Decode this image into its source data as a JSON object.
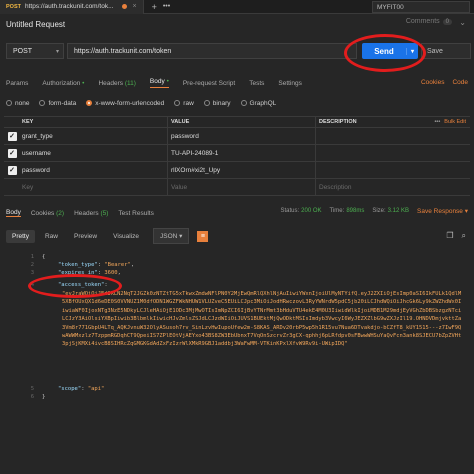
{
  "tabs": [
    {
      "method": "POST",
      "url": "https://auth.trackunit.com/tok..."
    }
  ],
  "environment": "MYFIT00",
  "request": {
    "title": "Untitled Request",
    "comments_label": "Comments",
    "comments_count": "0",
    "method": "POST",
    "url": "https://auth.trackunit.com/token",
    "send_label": "Send",
    "save_label": "Save"
  },
  "request_tabs": [
    {
      "label": "Params"
    },
    {
      "label": "Authorization",
      "indicator": "•"
    },
    {
      "label": "Headers",
      "count": "(11)"
    },
    {
      "label": "Body",
      "indicator": "•"
    },
    {
      "label": "Pre-request Script"
    },
    {
      "label": "Tests"
    },
    {
      "label": "Settings"
    }
  ],
  "request_tab_links": {
    "cookies": "Cookies",
    "code": "Code"
  },
  "body_types": [
    "none",
    "form-data",
    "x-www-form-urlencoded",
    "raw",
    "binary",
    "GraphQL"
  ],
  "body_type_selected": "x-www-form-urlencoded",
  "params_table": {
    "headers": {
      "key": "KEY",
      "value": "VALUE",
      "description": "DESCRIPTION",
      "bulk": "Bulk Edit"
    },
    "rows": [
      {
        "key": "grant_type",
        "value": "password"
      },
      {
        "key": "username",
        "value": "TU-API-24089-1"
      },
      {
        "key": "password",
        "value": "rllXOrn#xi2t_Upy"
      }
    ],
    "placeholders": {
      "key": "Key",
      "value": "Value",
      "description": "Description"
    }
  },
  "response_tabs": [
    {
      "label": "Body"
    },
    {
      "label": "Cookies",
      "count": "(2)"
    },
    {
      "label": "Headers",
      "count": "(5)"
    },
    {
      "label": "Test Results"
    }
  ],
  "response_meta": {
    "status_label": "Status:",
    "status": "200 OK",
    "time_label": "Time:",
    "time": "898ms",
    "size_label": "Size:",
    "size": "3.12 KB",
    "save_label": "Save Response"
  },
  "format_buttons": [
    "Pretty",
    "Raw",
    "Preview",
    "Visualize"
  ],
  "format_selected": "Pretty",
  "format_type": "JSON",
  "code": {
    "line_numbers": [
      "1",
      "2",
      "3",
      "4",
      "5",
      "6"
    ],
    "open_brace": "{",
    "token_type_key": "\"token_type\"",
    "token_type_value": "\"Bearer\"",
    "expires_key": "\"expires_in\"",
    "expires_value": "3600",
    "access_token_key": "\"access_token\"",
    "access_token_value": "\"eyJraWQiOiJEd3RLN2NqT2JGZk0zNTZtTG5xTkwxZmdwNFlPN0Y2MjEwQmRlQXhlNjAuIiwiYWxnIjoiUlMyNTYifQ.eyJ2ZXIiOjEsImp0aSI6IkFULk1QdlM5XBfOUxQX1d6eDE0S0VVNUZ1M0dfODN1WGZFWkNHUW1VLUZveC5EUiLCJpc3MiOiJodHRwczovL3RyYWNrdW5pdC5jb20iLCJhdWQiOiJhcGk6Ly9kZWZhdWx0IiwiaWF0IjoxNTg3NzE5NDkyLCJleHAiOjE1ODc3MjMwOTIsImNpZCI6IjBvYTNrMmt3bHduVTU4ekE4M0U3IiwidWlkIjoiMDB1M29mdjEyVGhZbDBSbzgzNTciLCJzY3AiOlsiYXBpIiwib3BlbmlkIiwicHJvZmlsZSJdLCJzdWIiOiJUVS1BUEktMjQwODktMSIsImdyb3VwcyI6WyJEZXZlbG9wZXJzIl19.OHNDVDmjvkttZa3Vm8r771GbpU4LTq_AQKJvnuW32OlyASusoh7rv_SinLzvHwIupoUfew2m-S8KAS_ARDv20rbP5wp5h1R15vu7Nua6DTvakdjo-bCZfT8_kUY1515---z7IwF9QwAWWMxzlz7TzppmRGDqhCT9QpeiIS7ZPlEOtVjAEYxo43BS8ZW3EbUbnxT7VqOnSzcrvZr3gCX-qphhj6pLRfdpv0sFBwwWHSuYaQvFcn3ank8SJECU7bZpZVHt3pjSjKMXi4ivcB8SIHRcZqGMGKGdAdZxFzIzrWlXMkR9GBJ1addbj3WaFwMM-VTKinKPxlXfvW9Rv9i-UWipIDQ\"",
    "scope_key": "\"scope\"",
    "scope_value": "\"api\"",
    "close_brace": "}"
  }
}
